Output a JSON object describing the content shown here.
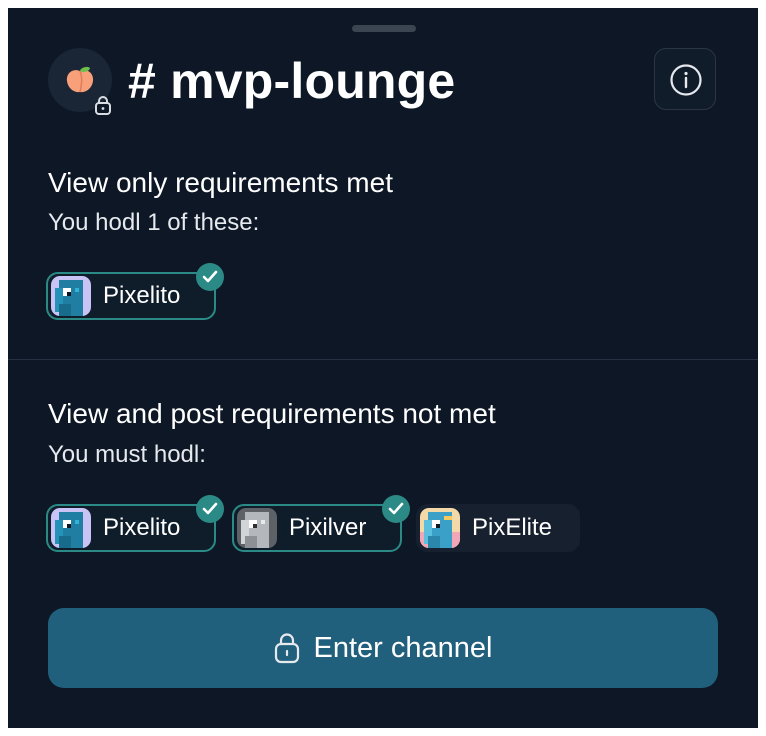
{
  "channel": {
    "name": "# mvp-lounge",
    "avatar_icon": "peach-icon",
    "lock_badge_icon": "lock-icon"
  },
  "header": {
    "info_icon": "info-icon"
  },
  "view_only": {
    "heading": "View only requirements met",
    "subtext": "You hodl 1 of these:",
    "tokens": [
      {
        "label": "Pixelito",
        "status": "met"
      }
    ]
  },
  "view_and_post": {
    "heading": "View and post requirements not met",
    "subtext": "You must hodl:",
    "tokens": [
      {
        "label": "Pixelito",
        "status": "met"
      },
      {
        "label": "Pixilver",
        "status": "met"
      },
      {
        "label": "PixElite",
        "status": "unmet"
      }
    ]
  },
  "enter_button": {
    "label": "Enter channel",
    "icon": "lock-icon"
  },
  "colors": {
    "panel_bg": "#0d1725",
    "accent_teal": "#2b8a86",
    "button_bg": "#21607c"
  }
}
